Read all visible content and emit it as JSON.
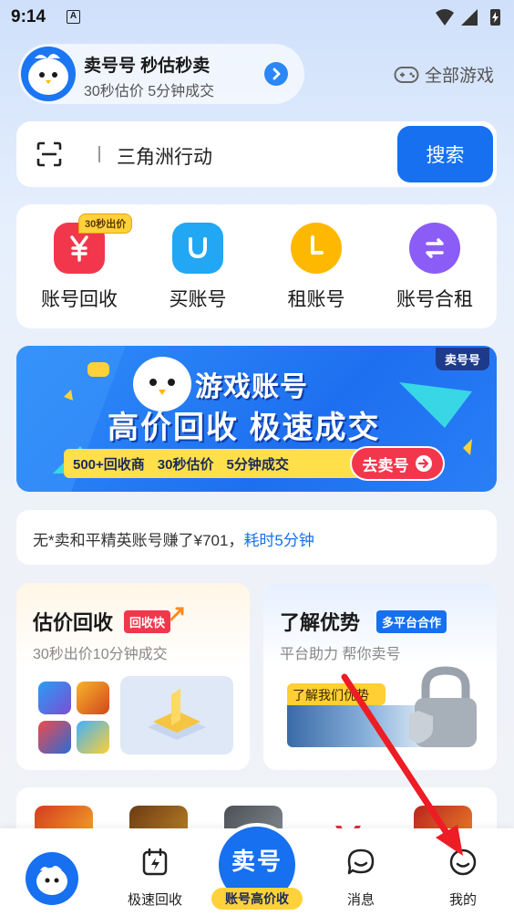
{
  "status_bar": {
    "time": "9:14",
    "a_icon": "A"
  },
  "promo": {
    "title": "卖号号 秒估秒卖",
    "subtitle": "30秒估价 5分钟成交"
  },
  "all_games": {
    "label": "全部游戏",
    "icon": "gamepad-icon"
  },
  "search": {
    "value": "三角洲行动",
    "button": "搜索"
  },
  "quick_actions": {
    "badge": "30秒出价",
    "items": [
      {
        "label": "账号回收",
        "icon": "yuan-icon",
        "color": "#f2374c"
      },
      {
        "label": "买账号",
        "icon": "bag-icon",
        "color": "#21a7f3"
      },
      {
        "label": "租账号",
        "icon": "clock-icon",
        "color": "#ffb800"
      },
      {
        "label": "账号合租",
        "icon": "swap-icon",
        "color": "#8b5cf6"
      }
    ]
  },
  "banner": {
    "tag": "卖号号",
    "title": "游戏账号",
    "headline": "高价回收 极速成交",
    "features": [
      "500+回收商",
      "30秒估价",
      "5分钟成交"
    ],
    "cta": "去卖号"
  },
  "ticker": {
    "text": "无*卖和平精英账号赚了¥701，",
    "highlight": "耗时5分钟"
  },
  "cards": {
    "left": {
      "title": "估价回收",
      "badge": "回收快",
      "subtitle": "30秒出价10分钟成交"
    },
    "right": {
      "title": "了解优势",
      "badge": "多平台合作",
      "subtitle": "平台助力 帮你卖号",
      "strip": "了解我们优势"
    }
  },
  "bottom_nav": {
    "items": [
      {
        "label": "",
        "icon": "home-logo-icon"
      },
      {
        "label": "极速回收",
        "icon": "lightning-box-icon"
      },
      {
        "label": "卖号",
        "icon": ""
      },
      {
        "label": "消息",
        "icon": "message-icon"
      },
      {
        "label": "我的",
        "icon": "profile-icon"
      }
    ],
    "center_tag": "账号高价收"
  },
  "colors": {
    "accent": "#1670f0",
    "badge_yellow": "#ffd23b",
    "red": "#f2374c"
  }
}
